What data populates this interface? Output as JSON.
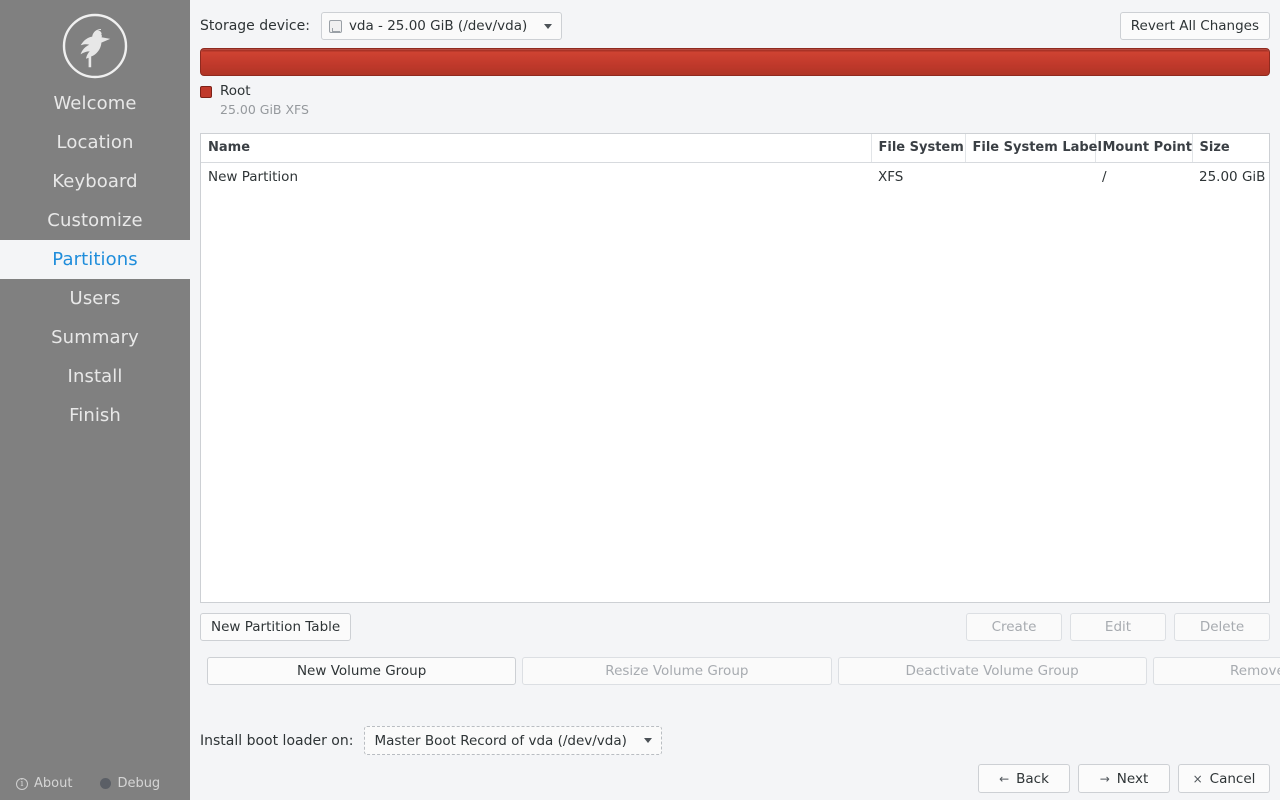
{
  "sidebar": {
    "logo": "calamares-bird-logo",
    "items": [
      {
        "label": "Welcome",
        "active": false
      },
      {
        "label": "Location",
        "active": false
      },
      {
        "label": "Keyboard",
        "active": false
      },
      {
        "label": "Customize",
        "active": false
      },
      {
        "label": "Partitions",
        "active": true
      },
      {
        "label": "Users",
        "active": false
      },
      {
        "label": "Summary",
        "active": false
      },
      {
        "label": "Install",
        "active": false
      },
      {
        "label": "Finish",
        "active": false
      }
    ],
    "footer": {
      "about_label": "About",
      "about_icon": "info-icon",
      "debug_label": "Debug",
      "debug_icon": "bug-icon"
    },
    "colors": {
      "background": "#808080",
      "active_background": "#f4f5f7",
      "active_text": "#1f8ddb",
      "text": "#e8e8e8"
    }
  },
  "toolbar": {
    "storage_device_label": "Storage device:",
    "storage_device_value": "vda - 25.00 GiB (/dev/vda)",
    "storage_device_icon": "drive-icon",
    "revert_label": "Revert All Changes"
  },
  "partition_bar": {
    "color": "#c0392b",
    "legend": {
      "name": "Root",
      "details": "25.00 GiB  XFS",
      "swatch_color": "#c0392b"
    }
  },
  "table": {
    "headers": [
      "Name",
      "File System",
      "File System Label",
      "Mount Point",
      "Size"
    ],
    "rows": [
      {
        "swatch_color": "#c0392b",
        "name": "New Partition",
        "file_system": "XFS",
        "file_system_label": "",
        "mount_point": "/",
        "size": "25.00 GiB"
      }
    ]
  },
  "partition_actions": {
    "new_partition_table": "New Partition Table",
    "create": "Create",
    "edit": "Edit",
    "delete": "Delete"
  },
  "volume_group_actions": {
    "new": "New Volume Group",
    "resize": "Resize Volume Group",
    "deactivate": "Deactivate Volume Group",
    "remove": "Remove Volume Group"
  },
  "bootloader": {
    "label": "Install boot loader on:",
    "value": "Master Boot Record of vda (/dev/vda)"
  },
  "navigation": {
    "back_icon": "←",
    "back_label": "Back",
    "next_icon": "→",
    "next_label": "Next",
    "cancel_icon": "×",
    "cancel_label": "Cancel"
  }
}
